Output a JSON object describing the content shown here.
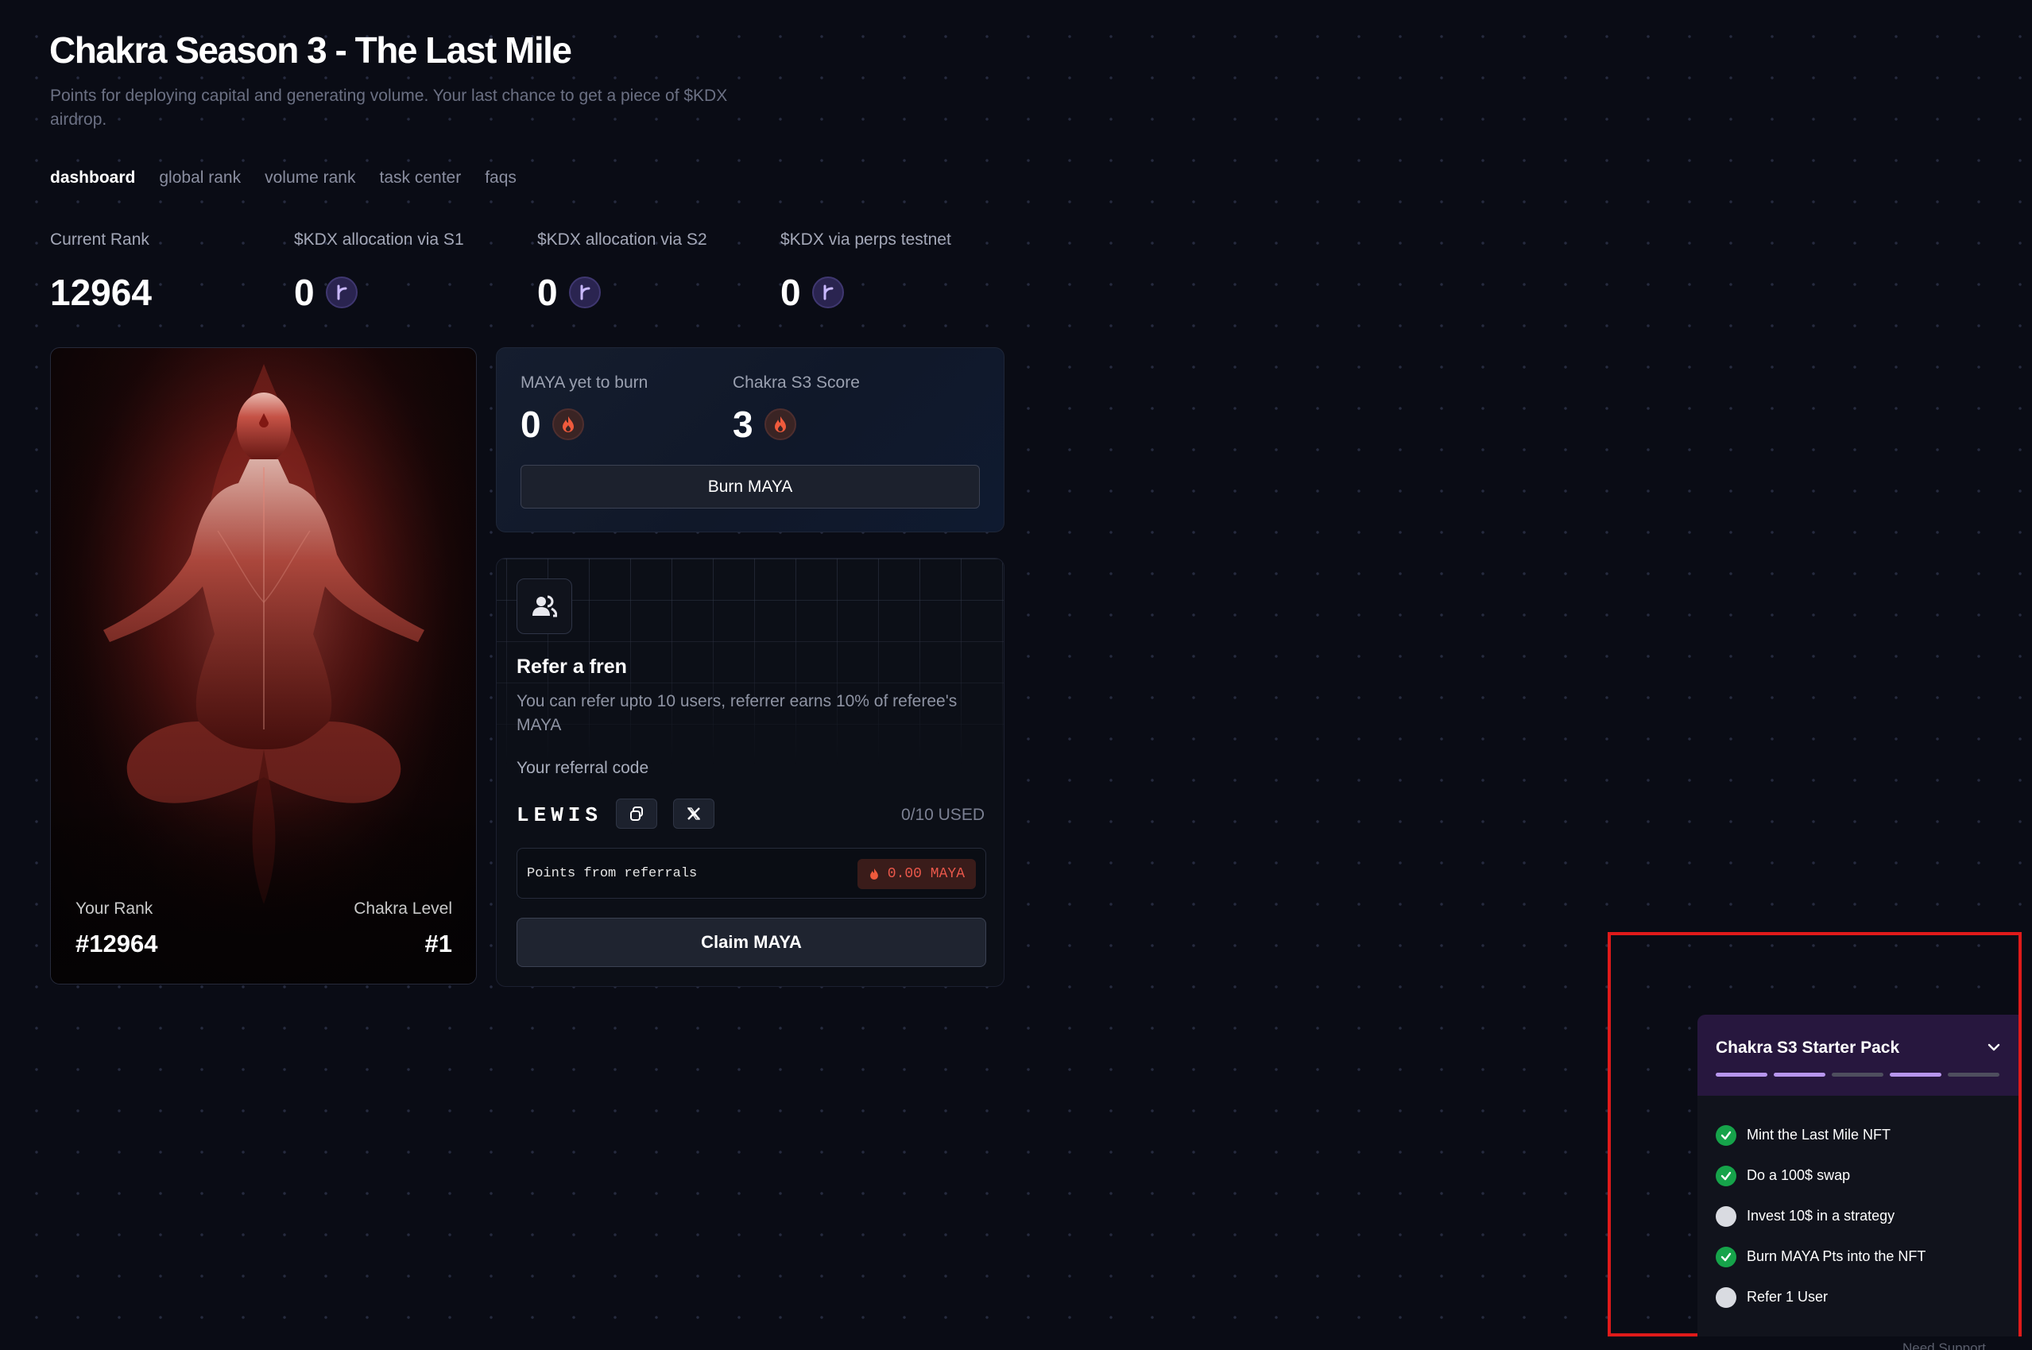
{
  "header": {
    "title": "Chakra Season 3 - The Last Mile",
    "subtitle": "Points for deploying capital and generating volume. Your last chance to get a piece of $KDX airdrop."
  },
  "tabs": [
    {
      "label": "dashboard",
      "active": true
    },
    {
      "label": "global rank",
      "active": false
    },
    {
      "label": "volume rank",
      "active": false
    },
    {
      "label": "task center",
      "active": false
    },
    {
      "label": "faqs",
      "active": false
    }
  ],
  "stats": [
    {
      "label": "Current Rank",
      "value": "12964",
      "icon": null
    },
    {
      "label": "$KDX allocation via S1",
      "value": "0",
      "icon": "kdx-token-icon"
    },
    {
      "label": "$KDX allocation via S2",
      "value": "0",
      "icon": "kdx-token-icon"
    },
    {
      "label": "$KDX via perps testnet",
      "value": "0",
      "icon": "kdx-token-icon"
    }
  ],
  "nft_card": {
    "rank_label": "Your Rank",
    "rank_value": "#12964",
    "level_label": "Chakra Level",
    "level_value": "#1"
  },
  "burn": {
    "maya_label": "MAYA yet to burn",
    "maya_value": "0",
    "score_label": "Chakra S3 Score",
    "score_value": "3",
    "button_label": "Burn MAYA"
  },
  "referral": {
    "title": "Refer a fren",
    "description": "You can refer upto 10 users, referrer earns 10% of referee's MAYA",
    "code_label": "Your referral code",
    "code": "LEWIS",
    "used": "0/10 USED",
    "points_label": "Points from referrals",
    "points_value": "0.00 MAYA",
    "claim_label": "Claim MAYA"
  },
  "starter_pack": {
    "title": "Chakra S3 Starter Pack",
    "progress": [
      true,
      true,
      false,
      true,
      false
    ],
    "items": [
      {
        "label": "Mint the Last Mile NFT",
        "done": true
      },
      {
        "label": "Do a 100$ swap",
        "done": true
      },
      {
        "label": "Invest 10$ in a strategy",
        "done": false
      },
      {
        "label": "Burn MAYA Pts into the NFT",
        "done": true
      },
      {
        "label": "Refer 1 User",
        "done": false
      }
    ]
  },
  "support": {
    "label": "Need Support"
  },
  "colors": {
    "background": "#0a0c15",
    "accent_purple": "#b896ee",
    "fire": "#e9574a",
    "success": "#16a34a",
    "highlight": "#e01a1a"
  }
}
